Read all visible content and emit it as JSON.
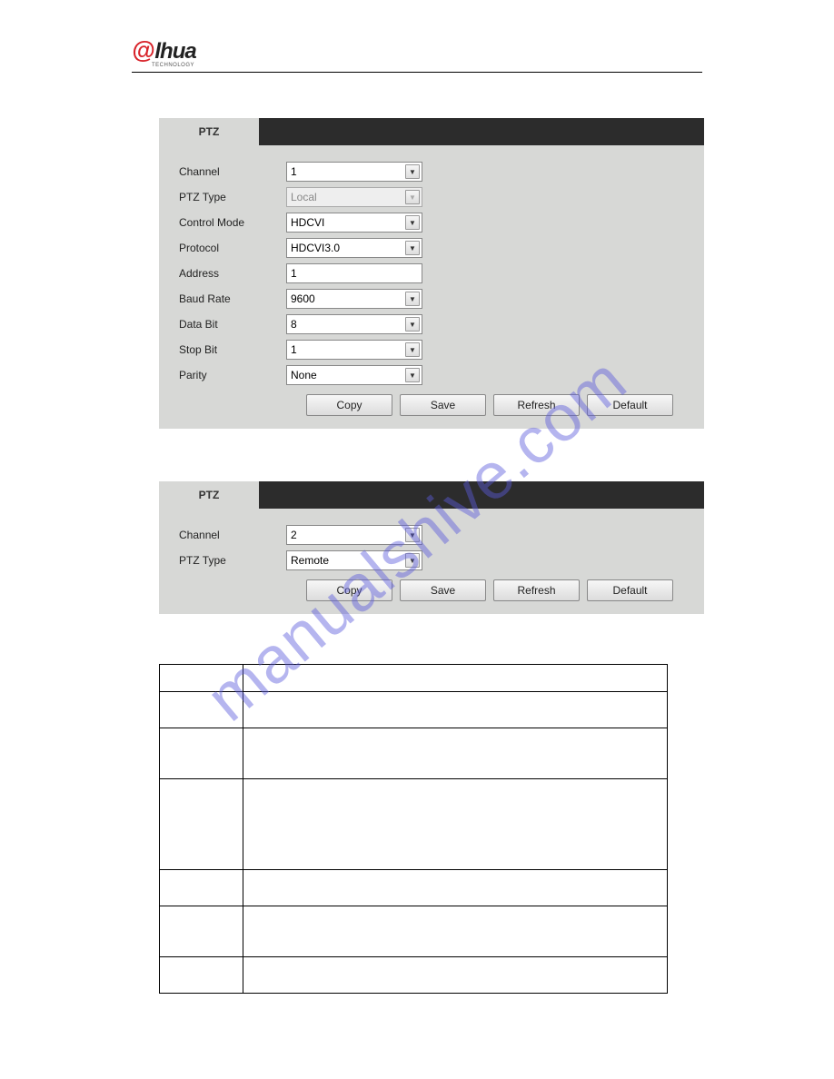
{
  "logo": {
    "a": "@",
    "rest": "lhua",
    "sub": "TECHNOLOGY"
  },
  "watermark": "manualshive.com",
  "panel1": {
    "tab": "PTZ",
    "rows": {
      "channel": {
        "label": "Channel",
        "value": "1"
      },
      "ptzType": {
        "label": "PTZ Type",
        "value": "Local"
      },
      "controlMode": {
        "label": "Control Mode",
        "value": "HDCVI"
      },
      "protocol": {
        "label": "Protocol",
        "value": "HDCVI3.0"
      },
      "address": {
        "label": "Address",
        "value": "1"
      },
      "baudRate": {
        "label": "Baud Rate",
        "value": "9600"
      },
      "dataBit": {
        "label": "Data Bit",
        "value": "8"
      },
      "stopBit": {
        "label": "Stop Bit",
        "value": "1"
      },
      "parity": {
        "label": "Parity",
        "value": "None"
      }
    },
    "buttons": {
      "copy": "Copy",
      "save": "Save",
      "refresh": "Refresh",
      "default": "Default"
    }
  },
  "panel2": {
    "tab": "PTZ",
    "rows": {
      "channel": {
        "label": "Channel",
        "value": "2"
      },
      "ptzType": {
        "label": "PTZ Type",
        "value": "Remote"
      }
    },
    "buttons": {
      "copy": "Copy",
      "save": "Save",
      "refresh": "Refresh",
      "default": "Default"
    }
  }
}
